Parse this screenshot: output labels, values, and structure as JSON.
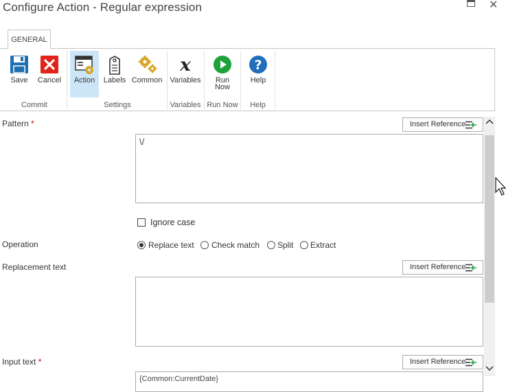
{
  "window": {
    "title": "Configure Action - Regular expression"
  },
  "ribbon": {
    "tab": "GENERAL",
    "buttons": {
      "save": "Save",
      "cancel": "Cancel",
      "action": "Action",
      "labels": "Labels",
      "common": "Common",
      "variables": "Variables",
      "run_now_1": "Run",
      "run_now_2": "Now",
      "help": "Help"
    },
    "groups": {
      "commit": "Commit",
      "settings": "Settings",
      "variables": "Variables",
      "run_now": "Run Now",
      "help": "Help"
    }
  },
  "form": {
    "pattern_label": "Pattern",
    "required_mark": "*",
    "pattern_value": "\\/",
    "insert_reference": "Insert Reference",
    "ignore_case_label": "Ignore case",
    "ignore_case_checked": false,
    "operation_label": "Operation",
    "operations": [
      "Replace text",
      "Check match",
      "Split",
      "Extract"
    ],
    "operation_selected": "Replace text",
    "replacement_label": "Replacement text",
    "replacement_value": "",
    "input_label": "Input text",
    "input_value": "{Common:CurrentDate}"
  },
  "colors": {
    "save": "#1e6fb3",
    "cancel": "#e2231a",
    "gear": "#d8a628",
    "run": "#1ea23a",
    "help": "#1f6fbb",
    "selected": "#cde6f7"
  }
}
